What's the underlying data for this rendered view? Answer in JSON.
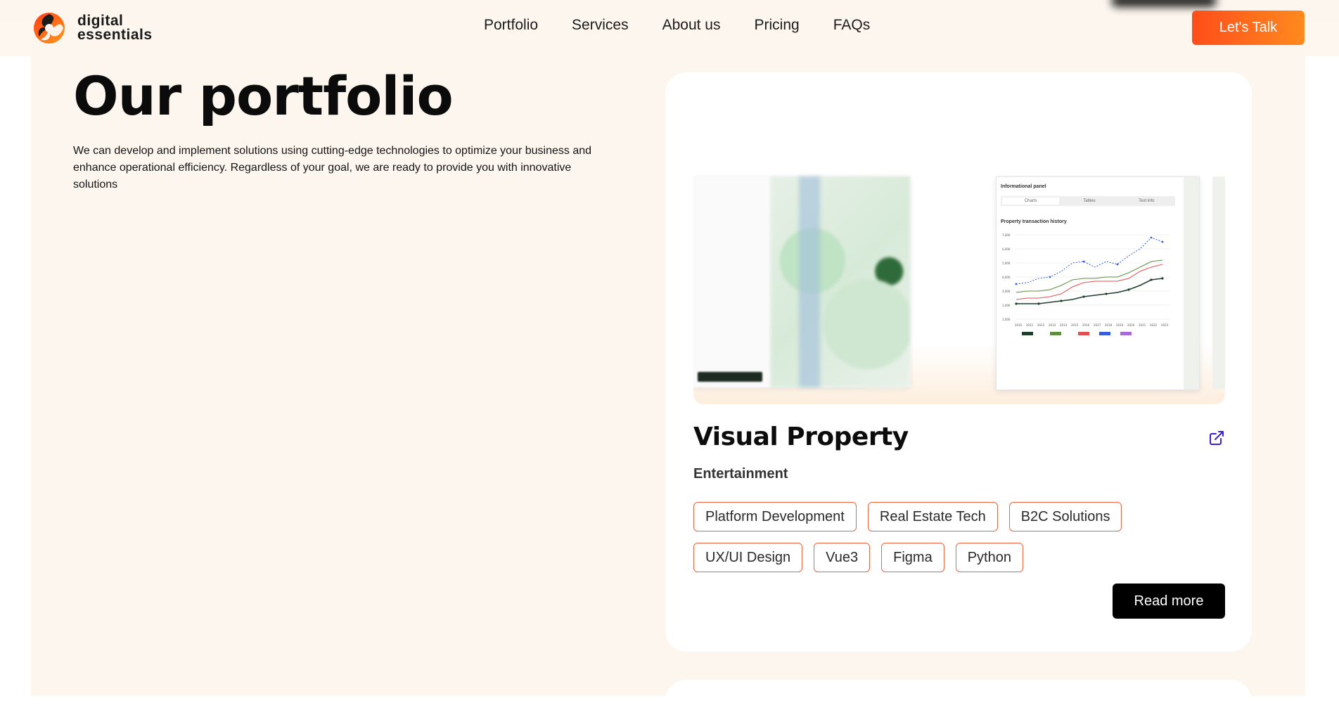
{
  "brand": {
    "line1": "digital",
    "line2": "essentials",
    "logo_icon": "swirl-logo-icon"
  },
  "nav": {
    "items": [
      "Portfolio",
      "Services",
      "About us",
      "Pricing",
      "FAQs"
    ]
  },
  "header": {
    "cta_label": "Let's Talk"
  },
  "hero": {
    "title": "Our portfolio",
    "description": "We can develop and implement solutions using cutting-edge technologies to optimize your business and enhance operational efficiency. Regardless of your goal, we are ready to provide you with innovative solutions"
  },
  "project": {
    "title": "Visual Property",
    "category": "Entertainment",
    "external_link_icon": "external-link-icon",
    "tags": [
      "Platform Development",
      "Real Estate Tech",
      "B2C Solutions",
      "UX/UI Design",
      "Vue3",
      "Figma",
      "Python"
    ],
    "read_more_label": "Read more",
    "preview": {
      "panel_title": "Informational panel",
      "tabs": [
        "Charts",
        "Tables",
        "Text info"
      ],
      "chart_title": "Property transaction history",
      "y_ticks": [
        "7,000",
        "6,000",
        "5,000",
        "4,000",
        "3,000",
        "2,000",
        "1,000"
      ],
      "x_ticks": [
        "2010",
        "2011",
        "2012",
        "2013",
        "2014",
        "2015",
        "2016",
        "2017",
        "2018",
        "2019",
        "2020",
        "2021",
        "2022",
        "2023"
      ]
    }
  },
  "colors": {
    "accent_start": "#ff4d1a",
    "accent_end": "#ff8a1f",
    "tag_border": "#f0623a",
    "page_bg": "#fdf6ee"
  }
}
